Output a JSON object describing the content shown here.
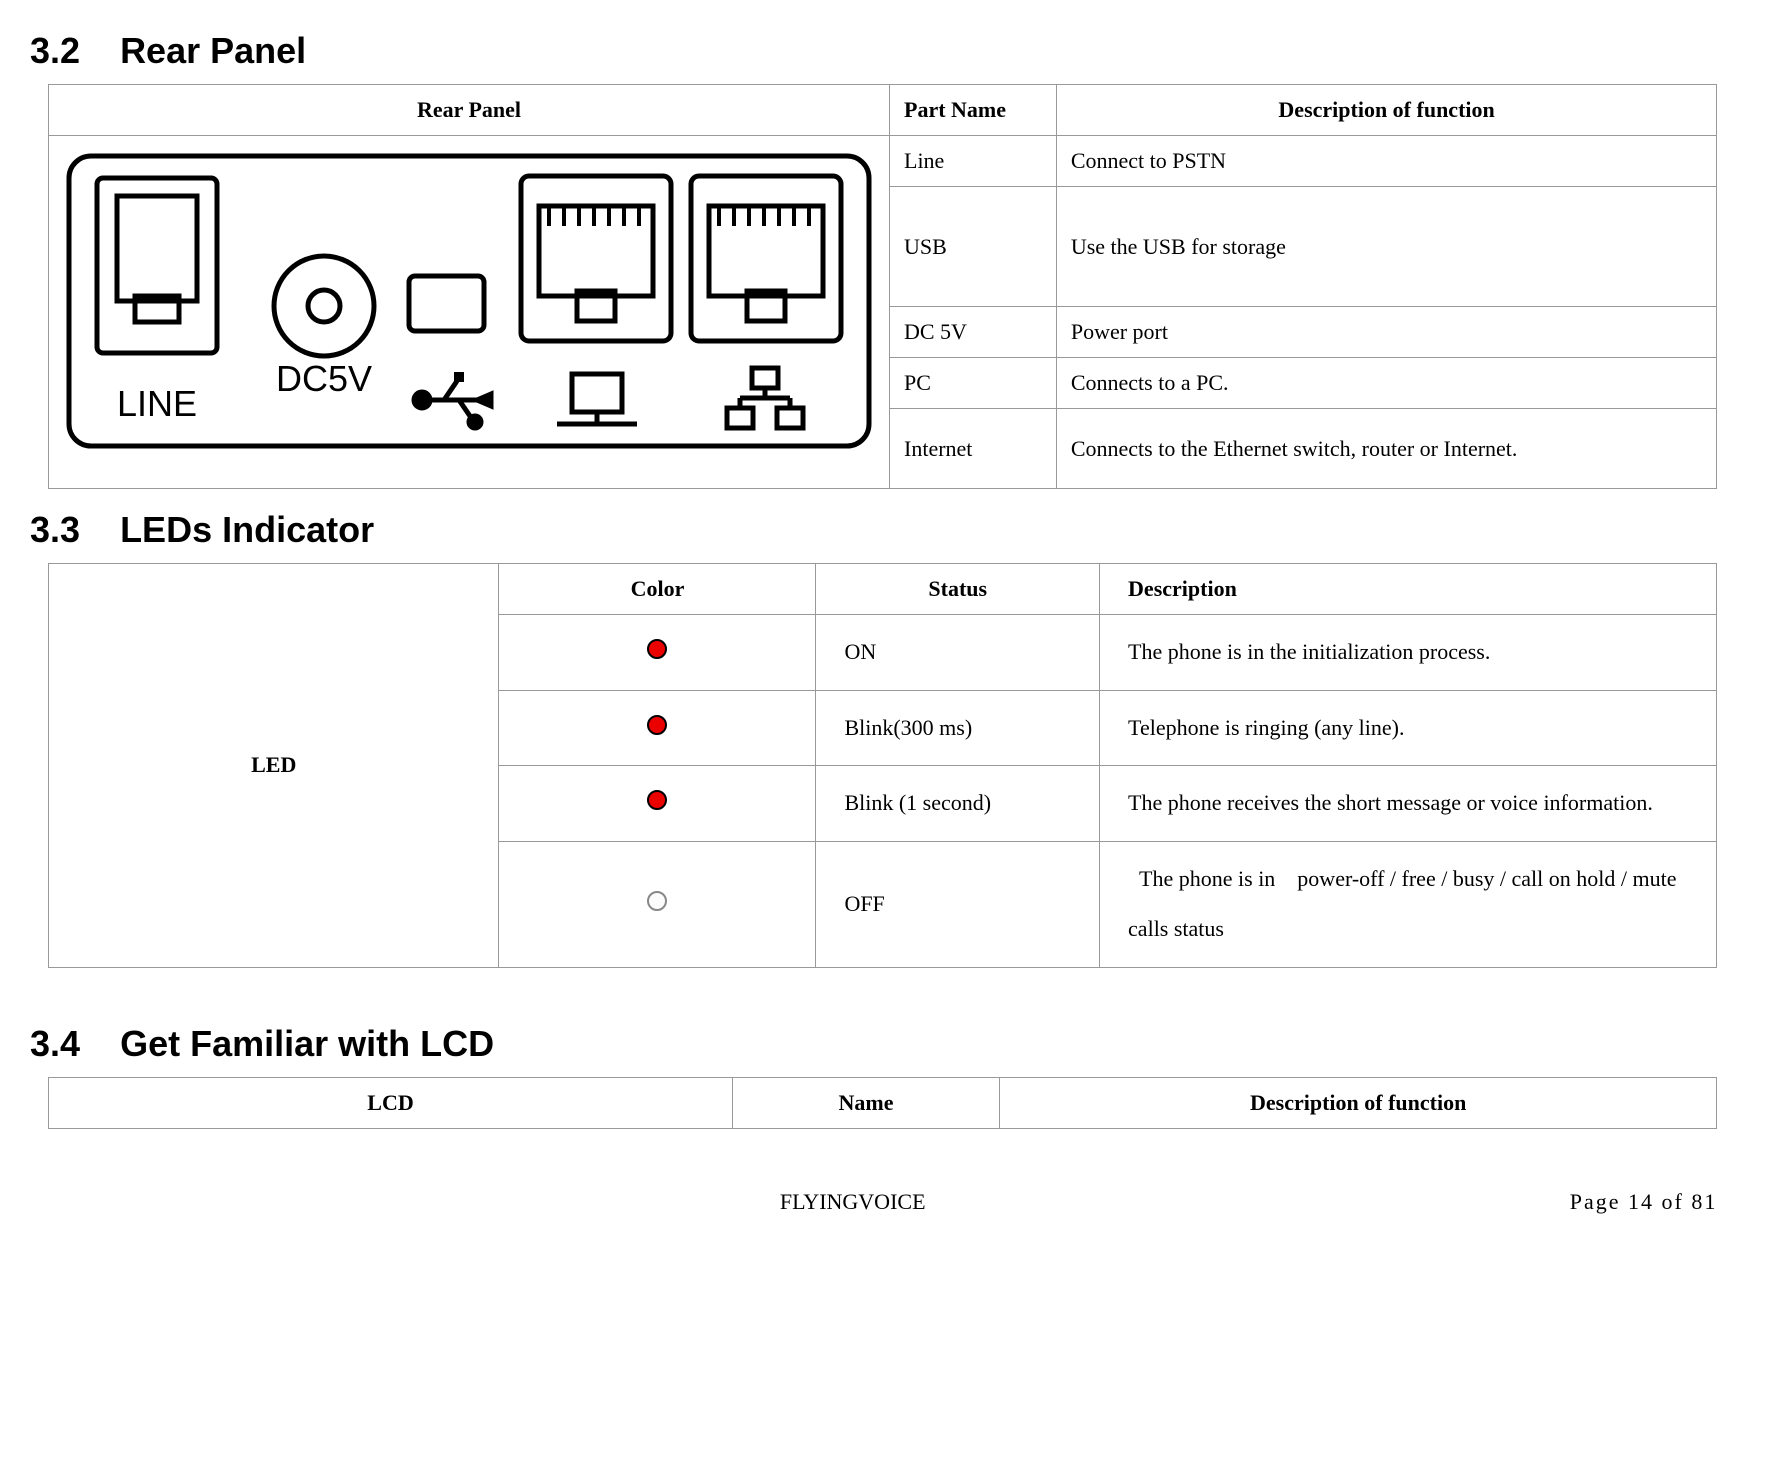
{
  "section32": {
    "number": "3.2",
    "title": "Rear Panel",
    "table": {
      "headers": {
        "left": "Rear Panel",
        "mid": "Part Name",
        "right": "Description of function"
      },
      "rows": [
        {
          "name": "Line",
          "desc": "Connect to PSTN"
        },
        {
          "name": "USB",
          "desc": "Use the USB for storage"
        },
        {
          "name": "DC 5V",
          "desc": "Power port"
        },
        {
          "name": "PC",
          "desc": "Connects to a PC."
        },
        {
          "name": "Internet",
          "desc": "Connects to the Ethernet switch, router or Internet."
        }
      ],
      "diagram_labels": {
        "line": "LINE",
        "dc5v": "DC5V"
      }
    }
  },
  "section33": {
    "number": "3.3",
    "title": "LEDs Indicator",
    "first_col": "LED",
    "headers": {
      "color": "Color",
      "status": "Status",
      "desc": "Description"
    },
    "rows": [
      {
        "color": "red",
        "status": "ON",
        "desc": "The phone is in the initialization process."
      },
      {
        "color": "red",
        "status": "Blink(300 ms)",
        "desc": "Telephone is ringing (any line)."
      },
      {
        "color": "red",
        "status": "Blink (1 second)",
        "desc": "The phone receives the short message or voice information."
      },
      {
        "color": "off",
        "status": "OFF",
        "desc": "  The phone is in    power-off / free / busy / call on hold / mute calls status"
      }
    ]
  },
  "section34": {
    "number": "3.4",
    "title": "Get Familiar with LCD",
    "headers": {
      "lcd": "LCD",
      "name": "Name",
      "desc": "Description of function"
    }
  },
  "footer": {
    "center": "FLYINGVOICE",
    "right": "Page  14  of  81"
  }
}
